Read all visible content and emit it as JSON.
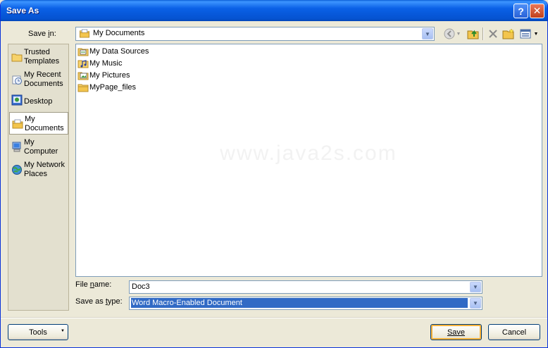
{
  "window": {
    "title": "Save As"
  },
  "title_buttons": {
    "help": "?",
    "close": "✕"
  },
  "save_in": {
    "label_pre": "Save ",
    "label_key": "i",
    "label_post": "n:",
    "value": "My Documents"
  },
  "places": [
    {
      "label": "Trusted Templates",
      "icon": "folder-icon"
    },
    {
      "label": "My Recent Documents",
      "icon": "recent-documents-icon"
    },
    {
      "label": "Desktop",
      "icon": "desktop-icon"
    },
    {
      "label": "My Documents",
      "icon": "my-documents-icon",
      "selected": true
    },
    {
      "label": "My Computer",
      "icon": "my-computer-icon"
    },
    {
      "label": "My Network Places",
      "icon": "network-places-icon"
    }
  ],
  "files": [
    {
      "name": "My Data Sources",
      "icon": "data-sources-folder-icon"
    },
    {
      "name": "My Music",
      "icon": "music-folder-icon"
    },
    {
      "name": "My Pictures",
      "icon": "pictures-folder-icon"
    },
    {
      "name": "MyPage_files",
      "icon": "folder-icon"
    }
  ],
  "watermark": "www.java2s.com",
  "file_name": {
    "label_pre": "File ",
    "label_key": "n",
    "label_post": "ame:",
    "value": "Doc3"
  },
  "save_as_type": {
    "label_pre": "Save as ",
    "label_key": "t",
    "label_post": "ype:",
    "value": "Word Macro-Enabled Document"
  },
  "buttons": {
    "tools": "Tools",
    "save": "Save",
    "cancel": "Cancel"
  },
  "colors": {
    "title_bar": "#0553d1",
    "selection": "#316ac5",
    "folder": "#f6d26b"
  }
}
